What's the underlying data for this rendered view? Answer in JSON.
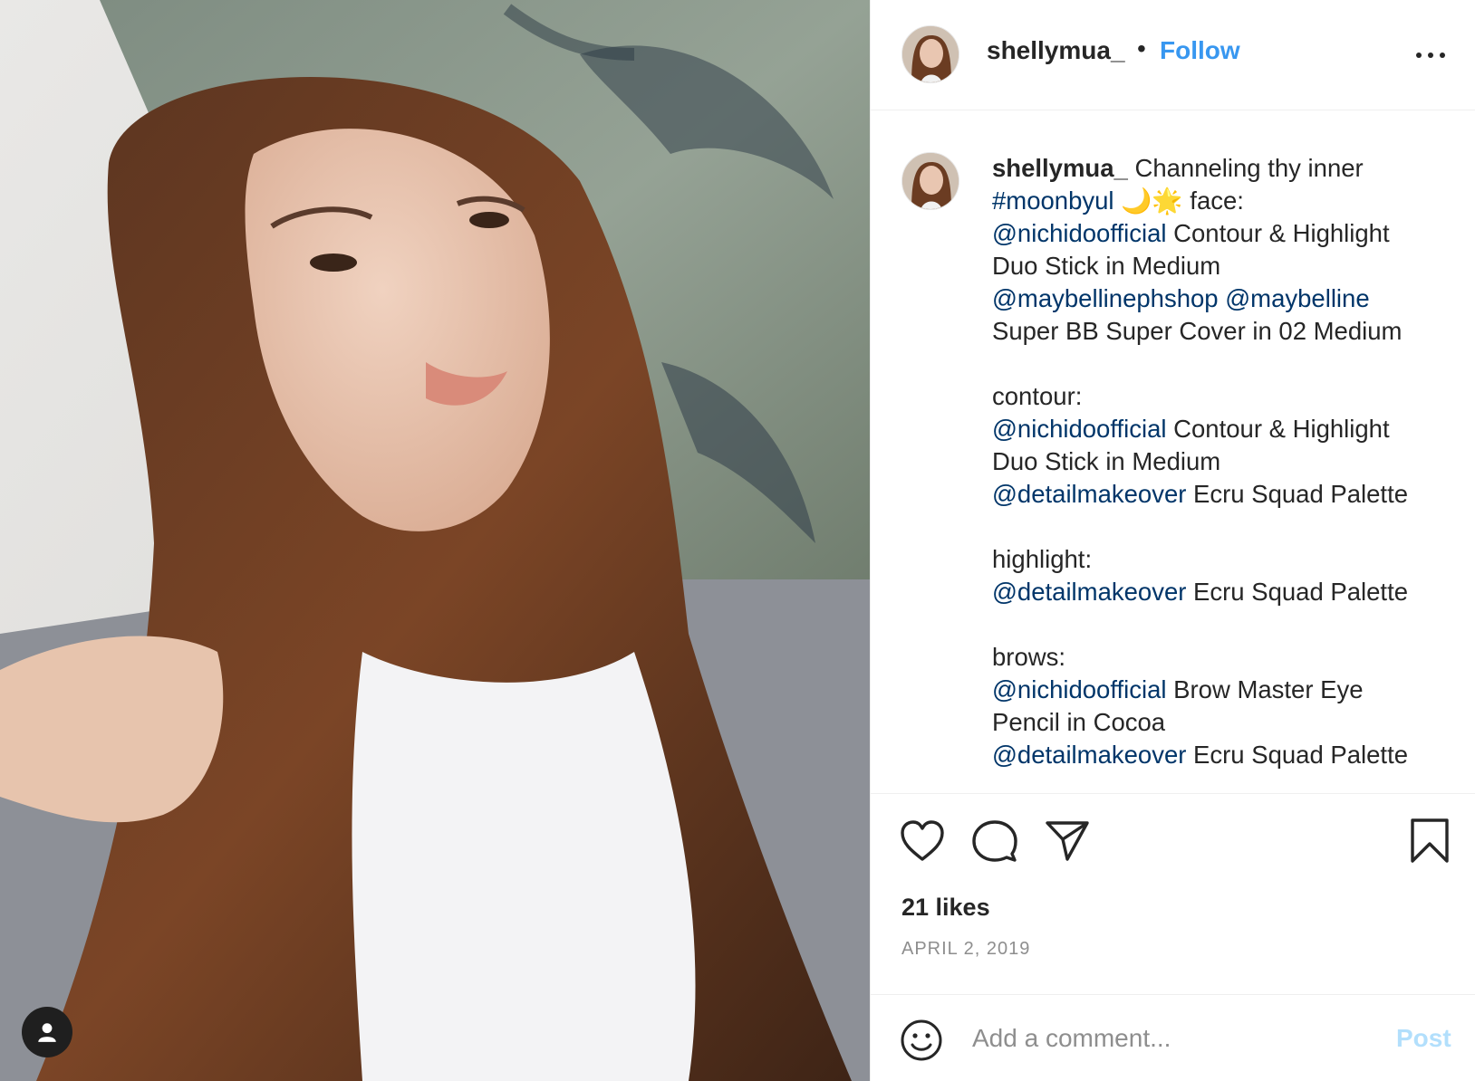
{
  "post": {
    "username": "shellymua_",
    "dot": "•",
    "follow_label": "Follow",
    "caption": {
      "username": "shellymua_",
      "l1_text": " Channeling thy inner",
      "l2_hashtag": "#moonbyul",
      "l2_emoji": "🌙🌟",
      "l2_text": " face:",
      "l3_mention": "@nichidoofficial",
      "l3_text": " Contour & Highlight",
      "l4_text": "Duo Stick in Medium",
      "l5_mention1": "@maybellinephshop",
      "l5_mention2": "@maybelline",
      "l6_text": "Super BB Super Cover in 02 Medium",
      "l7_text": "contour:",
      "l8_mention": "@nichidoofficial",
      "l8_text": " Contour & Highlight",
      "l9_text": "Duo Stick in Medium",
      "l10_mention": "@detailmakeover",
      "l10_text": " Ecru Squad Palette",
      "l11_text": "highlight:",
      "l12_mention": "@detailmakeover",
      "l12_text": " Ecru Squad Palette",
      "l13_text": "brows:",
      "l14_mention": "@nichidoofficial",
      "l14_text": " Brow Master Eye",
      "l15_text": "Pencil in Cocoa",
      "l16_mention": "@detailmakeover",
      "l16_text": " Ecru Squad Palette"
    },
    "likes": "21 likes",
    "date": "APRIL 2, 2019",
    "comment_placeholder": "Add a comment...",
    "post_label": "Post"
  },
  "icons": {
    "like": "heart-icon",
    "comment": "comment-icon",
    "share": "paper-plane-icon",
    "save": "bookmark-icon",
    "more": "more-options-icon",
    "emoji": "smiley-icon",
    "tag": "user-tag-icon"
  },
  "colors": {
    "link": "#003569",
    "follow": "#3897f0",
    "post_disabled": "#b2dffc",
    "muted": "#8e8e8e"
  }
}
